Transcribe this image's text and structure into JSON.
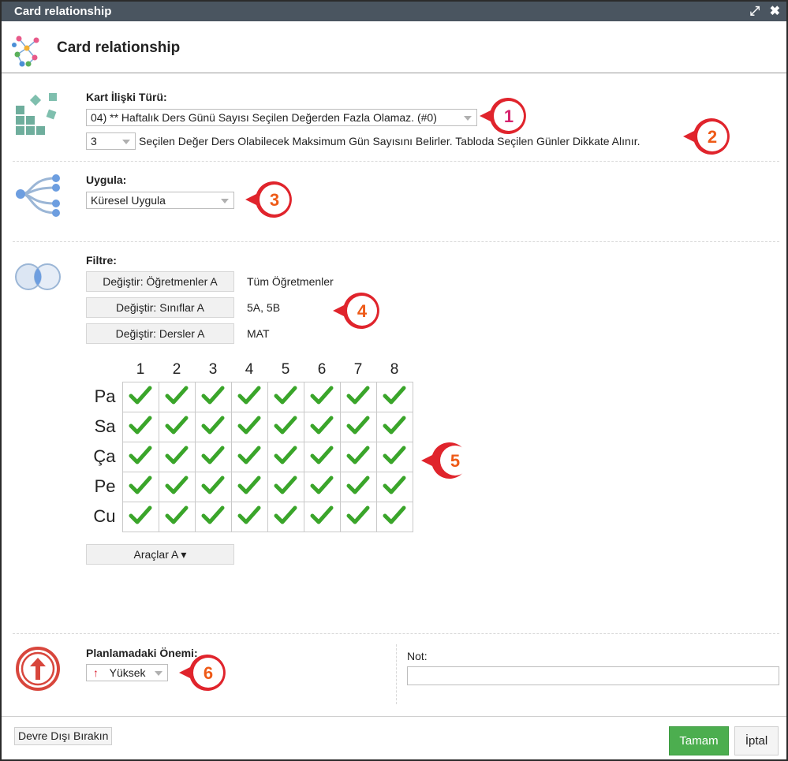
{
  "window": {
    "title": "Card relationship",
    "maximize_icon": "expand-icon",
    "close_icon": "close-icon"
  },
  "header": {
    "title": "Card relationship",
    "icon": "network-graph-icon"
  },
  "relation": {
    "label": "Kart İlişki Türü:",
    "type_value": "04) ** Haftalık Ders Günü Sayısı Seçilen Değerden Fazla Olamaz. (#0)",
    "count_value": "3",
    "count_description": "Seçilen Değer Ders Olabilecek Maksimum Gün Sayısını Belirler. Tabloda Seçilen Günler Dikkate Alınır."
  },
  "apply": {
    "label": "Uygula:",
    "value": "Küresel Uygula"
  },
  "filter": {
    "label": "Filtre:",
    "rows": [
      {
        "button": "Değiştir: Öğretmenler A",
        "value": "Tüm Öğretmenler"
      },
      {
        "button": "Değiştir: Sınıflar A",
        "value": "5A, 5B"
      },
      {
        "button": "Değiştir: Dersler A",
        "value": "MAT"
      }
    ]
  },
  "grid": {
    "columns": [
      "1",
      "2",
      "3",
      "4",
      "5",
      "6",
      "7",
      "8"
    ],
    "rows": [
      "Pa",
      "Sa",
      "Ça",
      "Pe",
      "Cu"
    ],
    "all_checked": true,
    "check_color": "#3aa52a"
  },
  "tools_button": "Araçlar A ▾",
  "priority": {
    "label": "Planlamadaki Önemi:",
    "value": "Yüksek",
    "icon": "arrow-up-icon"
  },
  "note": {
    "label": "Not:",
    "value": ""
  },
  "footer": {
    "disable": "Devre Dışı Bırakın",
    "ok": "Tamam",
    "cancel": "İptal"
  },
  "markers": [
    "1",
    "2",
    "3",
    "4",
    "5",
    "6"
  ],
  "colors": {
    "marker_red": "#e0242c",
    "marker_text_1": "#d6246e",
    "marker_text_other": "#ee5a17",
    "ok_green": "#4cae4f",
    "titlebar": "#4a5560"
  }
}
